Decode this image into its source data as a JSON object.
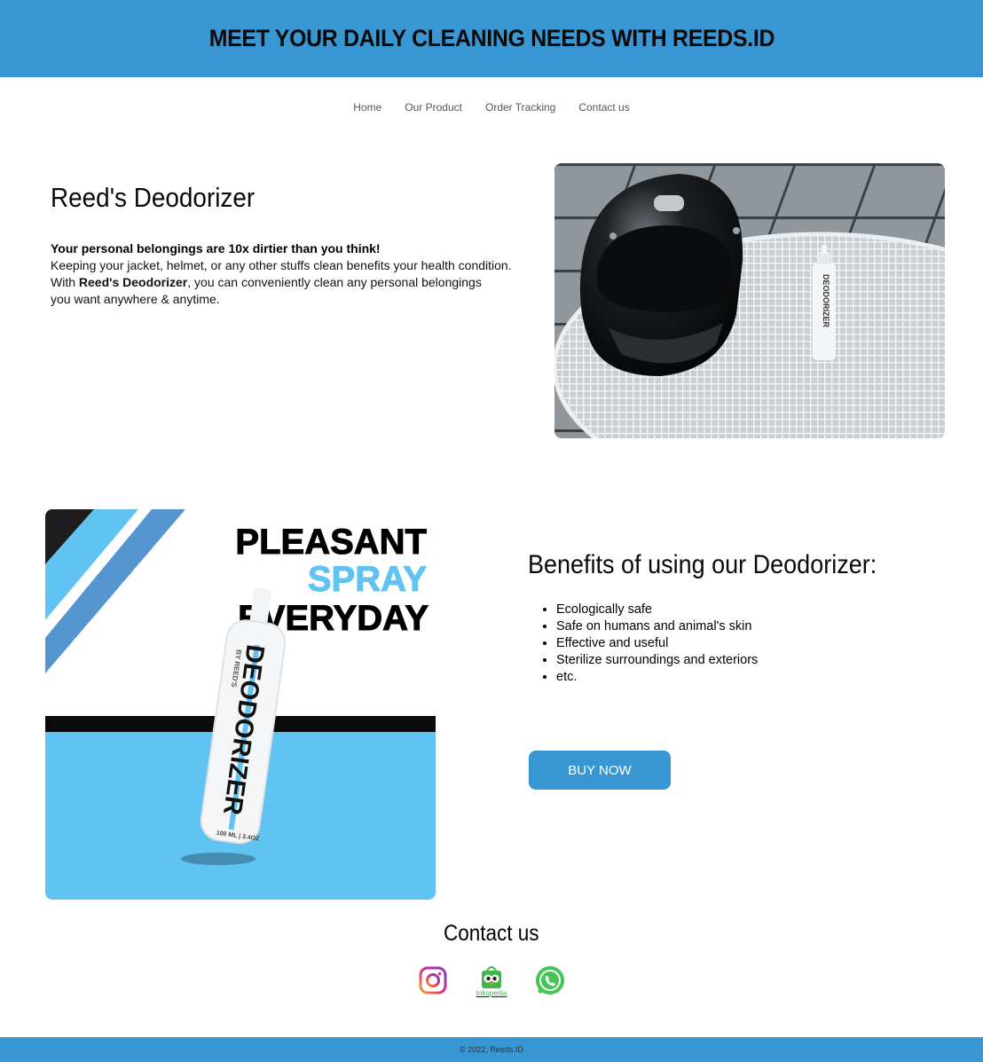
{
  "header": {
    "title": "MEET YOUR DAILY CLEANING NEEDS WITH REEDS.ID"
  },
  "nav": {
    "items": [
      "Home",
      "Our Product",
      "Order Tracking",
      "Contact us"
    ]
  },
  "hero": {
    "title": "Reed's Deodorizer",
    "lead": "Your personal belongings are 10x dirtier than you think!",
    "line1": "Keeping your jacket, helmet, or any other stuffs clean benefits your health condition.",
    "line2_prefix": "With ",
    "line2_bold": "Reed's Deodorizer",
    "line2_suffix": ", you can conveniently clean any personal belongings",
    "line3": "you want anywhere & anytime.",
    "photo_bottle_label": "DEODORIZER"
  },
  "promo": {
    "line1": "PLEASANT",
    "line2": "SPRAY",
    "line3": "EVERYDAY",
    "bottle_label": "DEODORIZER",
    "bottle_brand": "BY REED'S",
    "bottle_volume": "100 ML | 3.4OZ"
  },
  "benefits": {
    "title": "Benefits of using our Deodorizer:",
    "items": [
      "Ecologically safe",
      "Safe on humans and animal's skin",
      "Effective and useful",
      "Sterilize surroundings and exteriors",
      "etc."
    ]
  },
  "buy_button": "BUY NOW",
  "contact": {
    "title": "Contact us",
    "tokopedia_label": "tokopedia"
  },
  "footer": {
    "copyright": "© 2022, Reeds.ID"
  },
  "colors": {
    "brand_blue": "#3897d3",
    "light_blue": "#60c3f1"
  },
  "icons": [
    "instagram-icon",
    "tokopedia-icon",
    "whatsapp-icon"
  ]
}
